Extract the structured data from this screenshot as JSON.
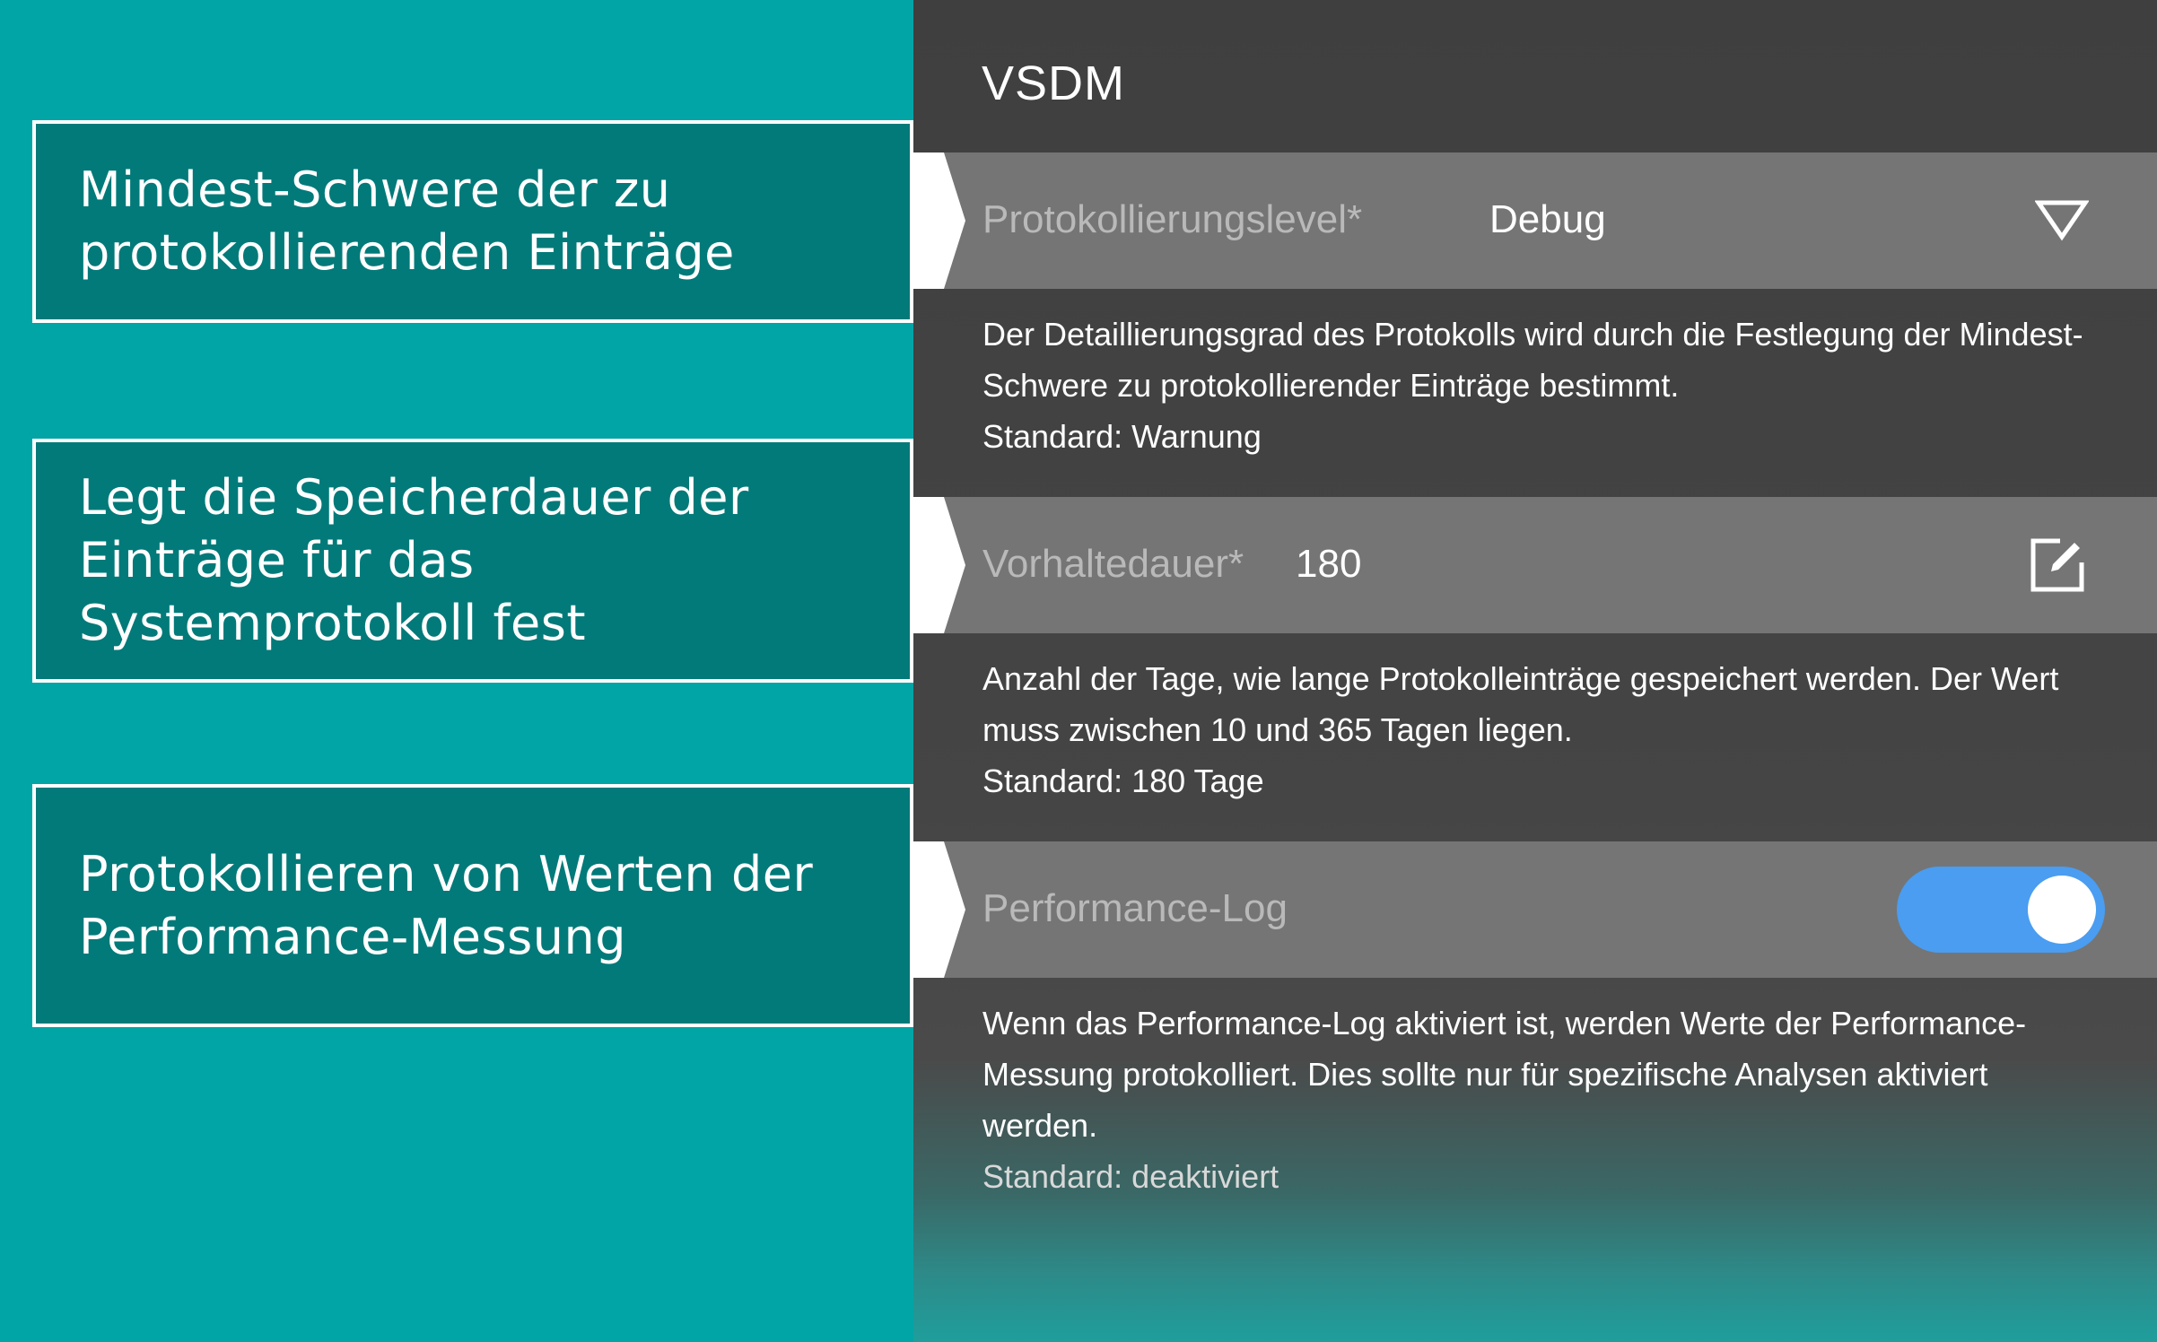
{
  "callouts": {
    "log_level": "Mindest-Schwere der zu\nprotokollierenden Einträge",
    "retention": "Legt die Speicherdauer der\nEinträge für das\nSystemprotokoll fest",
    "performance": "Protokollieren von Werten der\nPerformance-Messung"
  },
  "panel": {
    "title": "VSDM",
    "log_level": {
      "label": "Protokollierungslevel*",
      "value": "Debug",
      "icon": "dropdown-triangle-icon",
      "description_lines": [
        "Der Detaillierungsgrad des Protokolls wird durch die Festlegung der Mindest-",
        "Schwere zu protokollierender Einträge bestimmt."
      ],
      "default": "Standard: Warnung"
    },
    "retention": {
      "label": "Vorhaltedauer*",
      "value": "180",
      "icon": "edit-icon",
      "description_lines": [
        "Anzahl der Tage, wie lange Protokolleinträge gespeichert werden. Der Wert",
        "muss zwischen 10 und 365 Tagen liegen."
      ],
      "default": "Standard: 180 Tage"
    },
    "performance": {
      "label": "Performance-Log",
      "enabled": true,
      "description_lines": [
        "Wenn das Performance-Log aktiviert ist, werden Werte der Performance-",
        "Messung protokolliert. Dies sollte nur für spezifische Analysen aktiviert",
        "werden."
      ],
      "default": "Standard: deaktiviert"
    }
  },
  "colors": {
    "background": "#01a5a6",
    "callout": "#027a79",
    "row": "#757575",
    "toggle_on": "#4a9df0"
  }
}
